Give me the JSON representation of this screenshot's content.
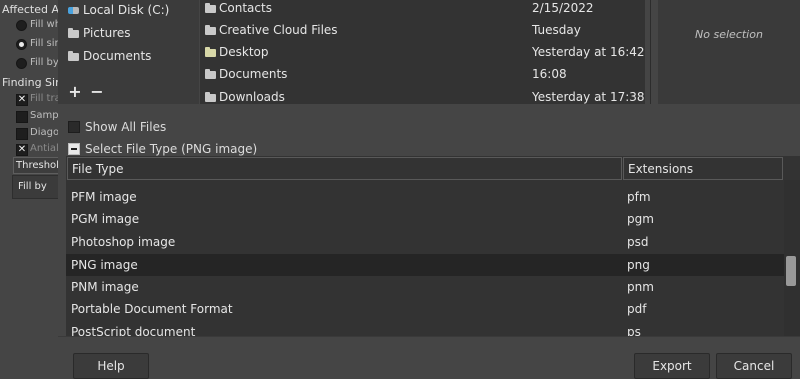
{
  "tool_options": {
    "affected_area_title": "Affected Are",
    "fill_whole": "Fill wh",
    "fill_similar": "Fill sim",
    "fill_by_line": "Fill by",
    "finding_similar_title": "Finding Simila",
    "fill_transparent": "Fill tra",
    "sample_merged": "Sampl",
    "diagonal": "Diago",
    "antialias": "Antiali",
    "threshold_label": "Threshold",
    "fill_by_dropdown": "Fill by"
  },
  "places": {
    "items": [
      {
        "label": "Local Disk (C:)",
        "icon": "drive-icon"
      },
      {
        "label": "Pictures",
        "icon": "folder-icon"
      },
      {
        "label": "Documents",
        "icon": "folder-icon"
      }
    ],
    "add_label": "+",
    "remove_label": "−"
  },
  "files": [
    {
      "name": "Contacts",
      "modified": "2/15/2022"
    },
    {
      "name": "Creative Cloud Files",
      "modified": "Tuesday"
    },
    {
      "name": "Desktop",
      "modified": "Yesterday at 16:42"
    },
    {
      "name": "Documents",
      "modified": "16:08"
    },
    {
      "name": "Downloads",
      "modified": "Yesterday at 17:38"
    }
  ],
  "preview": {
    "text": "No selection"
  },
  "show_all_files": "Show All Files",
  "select_file_type": "Select File Type (PNG image)",
  "filetype_table": {
    "headers": {
      "type": "File Type",
      "ext": "Extensions"
    },
    "rows": [
      {
        "type": "PFM image",
        "ext": "pfm"
      },
      {
        "type": "PGM image",
        "ext": "pgm"
      },
      {
        "type": "Photoshop image",
        "ext": "psd"
      },
      {
        "type": "PNG image",
        "ext": "png",
        "selected": true
      },
      {
        "type": "PNM image",
        "ext": "pnm"
      },
      {
        "type": "Portable Document Format",
        "ext": "pdf"
      },
      {
        "type": "PostScript document",
        "ext": "ps"
      }
    ]
  },
  "buttons": {
    "help": "Help",
    "export": "Export",
    "cancel": "Cancel"
  }
}
